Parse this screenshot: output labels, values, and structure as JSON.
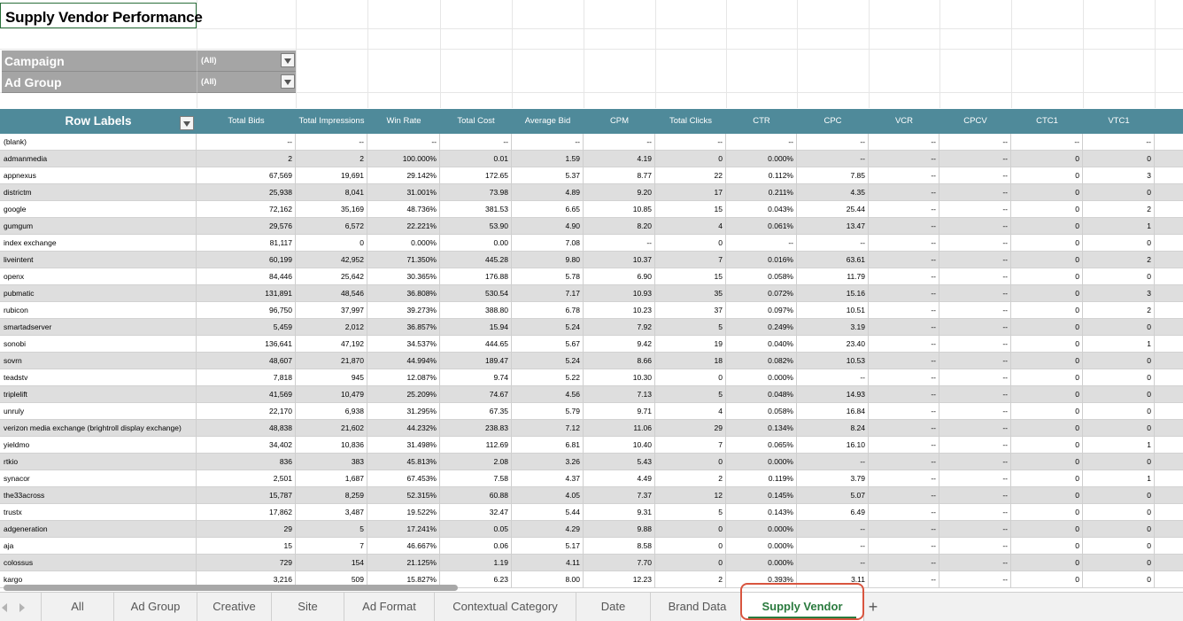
{
  "sheet_title": "Supply Vendor Performance",
  "filters": [
    {
      "label": "Campaign",
      "value": "(All)"
    },
    {
      "label": "Ad Group",
      "value": "(All)"
    }
  ],
  "pivot": {
    "row_labels_header": "Row Labels",
    "columns": [
      "Total Bids",
      "Total Impressions",
      "Win Rate",
      "Total Cost",
      "Average Bid",
      "CPM",
      "Total Clicks",
      "CTR",
      "CPC",
      "VCR",
      "CPCV",
      "CTC1",
      "VTC1"
    ],
    "rows": [
      [
        "(blank)",
        "--",
        "--",
        "--",
        "--",
        "--",
        "--",
        "--",
        "--",
        "--",
        "--",
        "--",
        "--",
        "--"
      ],
      [
        "admanmedia",
        "2",
        "2",
        "100.000%",
        "0.01",
        "1.59",
        "4.19",
        "0",
        "0.000%",
        "--",
        "--",
        "--",
        "0",
        "0"
      ],
      [
        "appnexus",
        "67,569",
        "19,691",
        "29.142%",
        "172.65",
        "5.37",
        "8.77",
        "22",
        "0.112%",
        "7.85",
        "--",
        "--",
        "0",
        "3"
      ],
      [
        "districtm",
        "25,938",
        "8,041",
        "31.001%",
        "73.98",
        "4.89",
        "9.20",
        "17",
        "0.211%",
        "4.35",
        "--",
        "--",
        "0",
        "0"
      ],
      [
        "google",
        "72,162",
        "35,169",
        "48.736%",
        "381.53",
        "6.65",
        "10.85",
        "15",
        "0.043%",
        "25.44",
        "--",
        "--",
        "0",
        "2"
      ],
      [
        "gumgum",
        "29,576",
        "6,572",
        "22.221%",
        "53.90",
        "4.90",
        "8.20",
        "4",
        "0.061%",
        "13.47",
        "--",
        "--",
        "0",
        "1"
      ],
      [
        "index exchange",
        "81,117",
        "0",
        "0.000%",
        "0.00",
        "7.08",
        "--",
        "0",
        "--",
        "--",
        "--",
        "--",
        "0",
        "0"
      ],
      [
        "liveintent",
        "60,199",
        "42,952",
        "71.350%",
        "445.28",
        "9.80",
        "10.37",
        "7",
        "0.016%",
        "63.61",
        "--",
        "--",
        "0",
        "2"
      ],
      [
        "openx",
        "84,446",
        "25,642",
        "30.365%",
        "176.88",
        "5.78",
        "6.90",
        "15",
        "0.058%",
        "11.79",
        "--",
        "--",
        "0",
        "0"
      ],
      [
        "pubmatic",
        "131,891",
        "48,546",
        "36.808%",
        "530.54",
        "7.17",
        "10.93",
        "35",
        "0.072%",
        "15.16",
        "--",
        "--",
        "0",
        "3"
      ],
      [
        "rubicon",
        "96,750",
        "37,997",
        "39.273%",
        "388.80",
        "6.78",
        "10.23",
        "37",
        "0.097%",
        "10.51",
        "--",
        "--",
        "0",
        "2"
      ],
      [
        "smartadserver",
        "5,459",
        "2,012",
        "36.857%",
        "15.94",
        "5.24",
        "7.92",
        "5",
        "0.249%",
        "3.19",
        "--",
        "--",
        "0",
        "0"
      ],
      [
        "sonobi",
        "136,641",
        "47,192",
        "34.537%",
        "444.65",
        "5.67",
        "9.42",
        "19",
        "0.040%",
        "23.40",
        "--",
        "--",
        "0",
        "1"
      ],
      [
        "sovrn",
        "48,607",
        "21,870",
        "44.994%",
        "189.47",
        "5.24",
        "8.66",
        "18",
        "0.082%",
        "10.53",
        "--",
        "--",
        "0",
        "0"
      ],
      [
        "teadstv",
        "7,818",
        "945",
        "12.087%",
        "9.74",
        "5.22",
        "10.30",
        "0",
        "0.000%",
        "--",
        "--",
        "--",
        "0",
        "0"
      ],
      [
        "triplelift",
        "41,569",
        "10,479",
        "25.209%",
        "74.67",
        "4.56",
        "7.13",
        "5",
        "0.048%",
        "14.93",
        "--",
        "--",
        "0",
        "0"
      ],
      [
        "unruly",
        "22,170",
        "6,938",
        "31.295%",
        "67.35",
        "5.79",
        "9.71",
        "4",
        "0.058%",
        "16.84",
        "--",
        "--",
        "0",
        "0"
      ],
      [
        "verizon media exchange (brightroll display exchange)",
        "48,838",
        "21,602",
        "44.232%",
        "238.83",
        "7.12",
        "11.06",
        "29",
        "0.134%",
        "8.24",
        "--",
        "--",
        "0",
        "0"
      ],
      [
        "yieldmo",
        "34,402",
        "10,836",
        "31.498%",
        "112.69",
        "6.81",
        "10.40",
        "7",
        "0.065%",
        "16.10",
        "--",
        "--",
        "0",
        "1"
      ],
      [
        "rtkio",
        "836",
        "383",
        "45.813%",
        "2.08",
        "3.26",
        "5.43",
        "0",
        "0.000%",
        "--",
        "--",
        "--",
        "0",
        "0"
      ],
      [
        "synacor",
        "2,501",
        "1,687",
        "67.453%",
        "7.58",
        "4.37",
        "4.49",
        "2",
        "0.119%",
        "3.79",
        "--",
        "--",
        "0",
        "1"
      ],
      [
        "the33across",
        "15,787",
        "8,259",
        "52.315%",
        "60.88",
        "4.05",
        "7.37",
        "12",
        "0.145%",
        "5.07",
        "--",
        "--",
        "0",
        "0"
      ],
      [
        "trustx",
        "17,862",
        "3,487",
        "19.522%",
        "32.47",
        "5.44",
        "9.31",
        "5",
        "0.143%",
        "6.49",
        "--",
        "--",
        "0",
        "0"
      ],
      [
        "adgeneration",
        "29",
        "5",
        "17.241%",
        "0.05",
        "4.29",
        "9.88",
        "0",
        "0.000%",
        "--",
        "--",
        "--",
        "0",
        "0"
      ],
      [
        "aja",
        "15",
        "7",
        "46.667%",
        "0.06",
        "5.17",
        "8.58",
        "0",
        "0.000%",
        "--",
        "--",
        "--",
        "0",
        "0"
      ],
      [
        "colossus",
        "729",
        "154",
        "21.125%",
        "1.19",
        "4.11",
        "7.70",
        "0",
        "0.000%",
        "--",
        "--",
        "--",
        "0",
        "0"
      ],
      [
        "kargo",
        "3,216",
        "509",
        "15.827%",
        "6.23",
        "8.00",
        "12.23",
        "2",
        "0.393%",
        "3.11",
        "--",
        "--",
        "0",
        "0"
      ]
    ]
  },
  "tabs": [
    {
      "label": "All",
      "active": false
    },
    {
      "label": "Ad Group",
      "active": false
    },
    {
      "label": "Creative",
      "active": false
    },
    {
      "label": "Site",
      "active": false
    },
    {
      "label": "Ad Format",
      "active": false
    },
    {
      "label": "Contextual Category",
      "active": false
    },
    {
      "label": "Date",
      "active": false
    },
    {
      "label": "Brand Data",
      "active": false
    },
    {
      "label": "Supply Vendor",
      "active": true
    }
  ],
  "add_sheet_label": "+",
  "colors": {
    "header_teal": "#4f8a9a",
    "filter_gray": "#a5a5a5",
    "alt_row": "#dedede",
    "active_tab_text": "#2a7a3e",
    "highlight_ring": "#d9553f"
  }
}
